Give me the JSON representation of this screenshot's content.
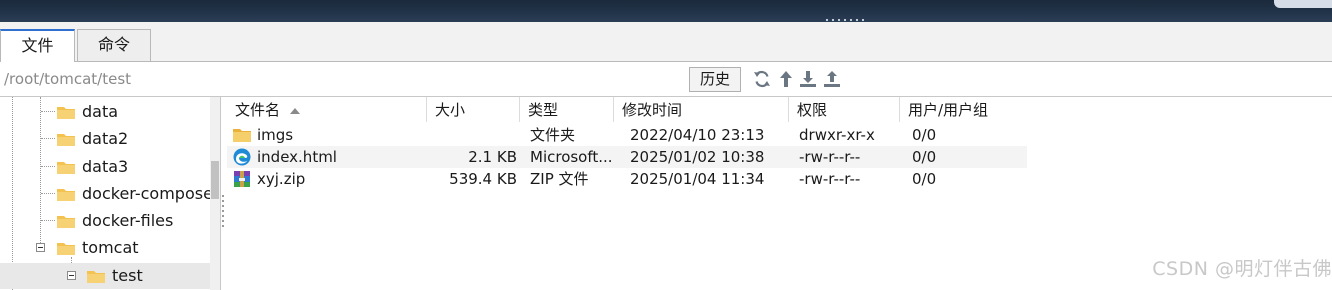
{
  "tabs": [
    {
      "label": "文件"
    },
    {
      "label": "命令"
    }
  ],
  "pathbar": {
    "path": "/root/tomcat/test",
    "history_label": "历史",
    "icons": [
      "refresh-icon",
      "up-arrow-icon",
      "download-icon",
      "upload-icon"
    ]
  },
  "tree": {
    "items": [
      {
        "label": "data"
      },
      {
        "label": "data2"
      },
      {
        "label": "data3"
      },
      {
        "label": "docker-compose"
      },
      {
        "label": "docker-files"
      },
      {
        "label": "tomcat"
      },
      {
        "label": "test"
      }
    ]
  },
  "filelist": {
    "columns": [
      "文件名",
      "大小",
      "类型",
      "修改时间",
      "权限",
      "用户/用户组"
    ],
    "rows": [
      {
        "name": "imgs",
        "size": "",
        "type": "文件夹",
        "modified": "2022/04/10 23:13",
        "perm": "drwxr-xr-x",
        "owner": "0/0",
        "icon": "folder-icon"
      },
      {
        "name": "index.html",
        "size": "2.1 KB",
        "type": "Microsoft...",
        "modified": "2025/01/02 10:38",
        "perm": "-rw-r--r--",
        "owner": "0/0",
        "icon": "edge-html-icon"
      },
      {
        "name": "xyj.zip",
        "size": "539.4 KB",
        "type": "ZIP 文件",
        "modified": "2025/01/04 11:34",
        "perm": "-rw-r--r--",
        "owner": "0/0",
        "icon": "zip-archive-icon"
      }
    ]
  },
  "watermark": "CSDN @明灯伴古佛",
  "colors": {
    "accent": "#2f6fcf",
    "folder": "#f3c24f",
    "topbar": "#1f3044"
  }
}
